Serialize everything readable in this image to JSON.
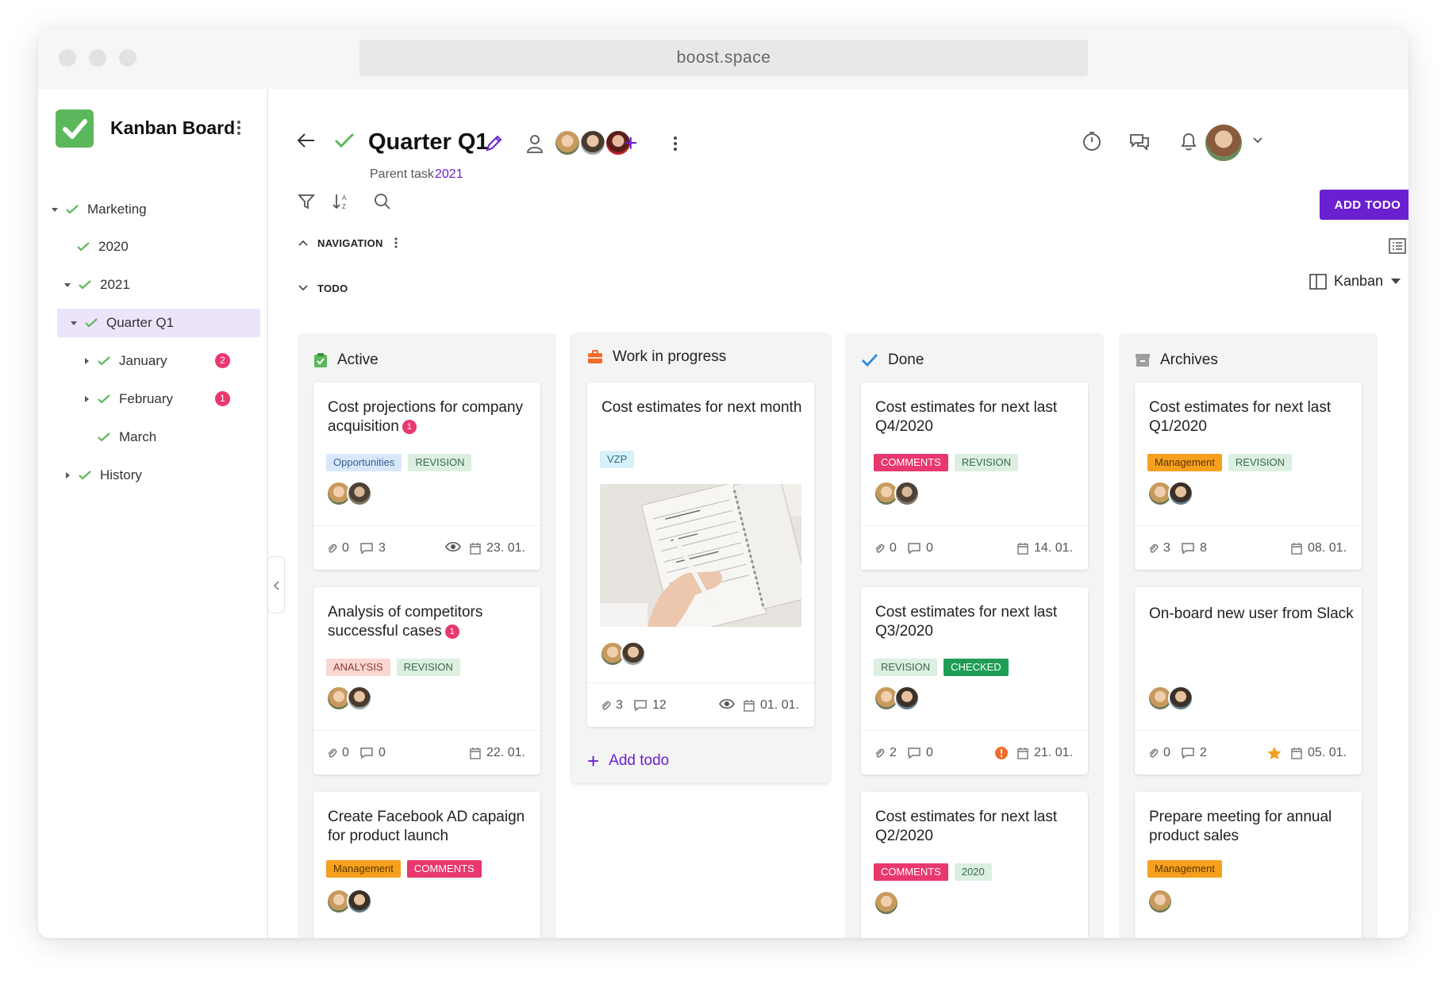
{
  "browser": {
    "url": "boost.space"
  },
  "sidebar": {
    "app_title": "Kanban Board",
    "items": [
      {
        "label": "Marketing",
        "badge": ""
      },
      {
        "label": "2020",
        "badge": ""
      },
      {
        "label": "2021",
        "badge": ""
      },
      {
        "label": "Quarter Q1",
        "badge": ""
      },
      {
        "label": "January",
        "badge": "2"
      },
      {
        "label": "February",
        "badge": "1"
      },
      {
        "label": "March",
        "badge": ""
      },
      {
        "label": "History",
        "badge": ""
      }
    ]
  },
  "header": {
    "title": "Quarter Q1",
    "parent_label": "Parent task",
    "parent_link": "2021",
    "add_todo_button": "ADD TODO"
  },
  "sections": {
    "navigation": "NAVIGATION",
    "todo": "TODO"
  },
  "view": {
    "current": "Kanban"
  },
  "colors": {
    "accent": "#6a1fd1",
    "badge": "#e8386d",
    "check": "#5cb85c"
  },
  "columns": [
    {
      "title": "Active",
      "icon": "clipboard-check-icon",
      "cards": [
        {
          "title": "Cost projections for company acquisition",
          "notif": "1",
          "tags": [
            "Opportunities",
            "REVISION"
          ],
          "attachments": "0",
          "comments": "3",
          "date": "23. 01."
        },
        {
          "title": "Analysis of competitors successful cases",
          "notif": "1",
          "tags": [
            "ANALYSIS",
            "REVISION"
          ],
          "attachments": "0",
          "comments": "0",
          "date": "22. 01."
        },
        {
          "title": "Create Facebook AD capaign for product launch",
          "notif": "",
          "tags": [
            "Management",
            "COMMENTS"
          ]
        }
      ]
    },
    {
      "title": "Work in progress",
      "icon": "briefcase-icon",
      "cards": [
        {
          "title": "Cost estimates for next month",
          "tags": [
            "VZP"
          ],
          "attachments": "3",
          "comments": "12",
          "date": "01. 01."
        }
      ],
      "add_label": "Add todo"
    },
    {
      "title": "Done",
      "icon": "check-icon",
      "cards": [
        {
          "title": "Cost estimates for next last Q4/2020",
          "tags": [
            "COMMENTS",
            "REVISION"
          ],
          "attachments": "0",
          "comments": "0",
          "date": "14. 01."
        },
        {
          "title": "Cost estimates for next last Q3/2020",
          "tags": [
            "REVISION",
            "CHECKED"
          ],
          "attachments": "2",
          "comments": "0",
          "date": "21. 01."
        },
        {
          "title": "Cost estimates for next last Q2/2020",
          "tags": [
            "COMMENTS",
            "2020"
          ]
        }
      ]
    },
    {
      "title": "Archives",
      "icon": "archive-icon",
      "cards": [
        {
          "title": "Cost estimates for next last Q1/2020",
          "tags": [
            "Management",
            "REVISION"
          ],
          "attachments": "3",
          "comments": "8",
          "date": "08. 01."
        },
        {
          "title": "On-board new user from Slack",
          "tags": [],
          "attachments": "0",
          "comments": "2",
          "date": "05. 01."
        },
        {
          "title": "Prepare meeting for annual product sales",
          "tags": [
            "Management"
          ]
        }
      ]
    }
  ]
}
